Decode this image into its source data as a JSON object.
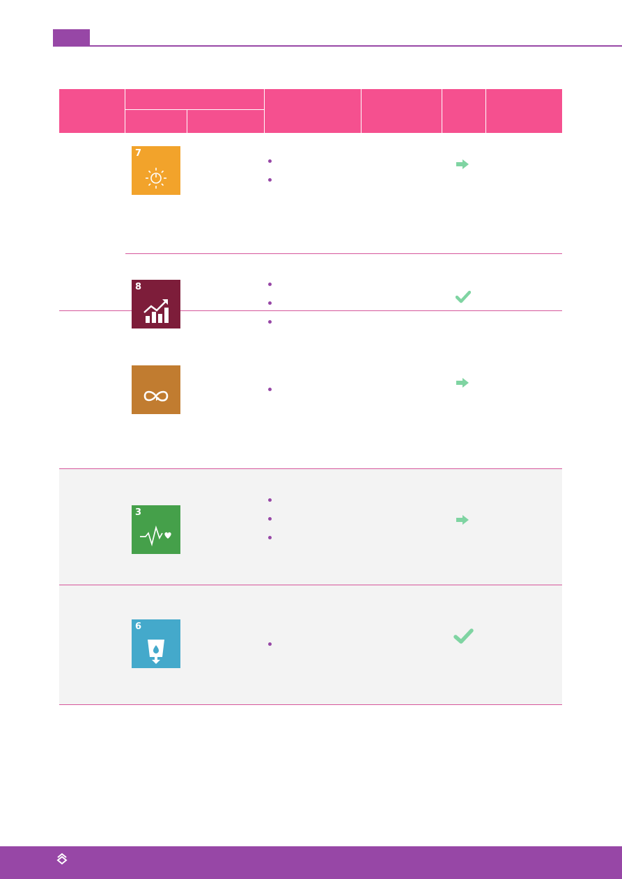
{
  "colors": {
    "header_bg": "#f5508f",
    "accent": "#9747a6",
    "row_shade": "#f3f3f3",
    "status_green": "#7fd4a2"
  },
  "table": {
    "rows": [
      {
        "sdg": {
          "number": "7",
          "color": "#f2a32b",
          "icon": "sun-power-icon"
        },
        "bullets": 2,
        "status": "arrow-right-icon"
      },
      {
        "sdg": {
          "number": "8",
          "color": "#7d1d3a",
          "icon": "growth-chart-icon"
        },
        "bullets": 3,
        "status": "checkmark-icon"
      },
      {
        "sdg": {
          "number": "",
          "color": "#c17c30",
          "icon": "infinity-loop-icon"
        },
        "bullets": 1,
        "status": "arrow-right-icon"
      },
      {
        "sdg": {
          "number": "3",
          "color": "#45a04a",
          "icon": "heartbeat-icon"
        },
        "bullets": 3,
        "status": "arrow-right-icon"
      },
      {
        "sdg": {
          "number": "6",
          "color": "#44a9cb",
          "icon": "water-glass-icon"
        },
        "bullets": 1,
        "status": "checkmark-icon"
      }
    ]
  },
  "footer": {
    "logo_icon": "brand-logo-icon"
  }
}
